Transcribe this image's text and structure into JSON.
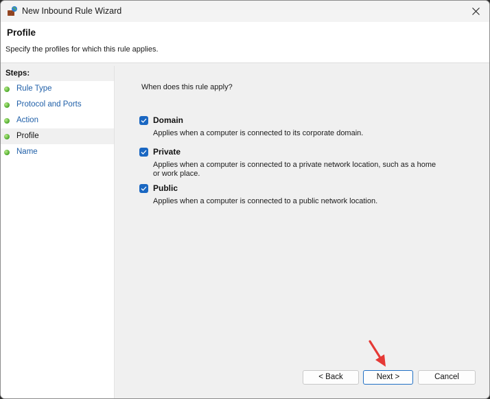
{
  "window": {
    "title": "New Inbound Rule Wizard",
    "icon": "firewall-icon",
    "close_icon": "close-icon"
  },
  "header": {
    "title": "Profile",
    "subtitle": "Specify the profiles for which this rule applies."
  },
  "sidebar": {
    "heading": "Steps:",
    "items": [
      {
        "label": "Rule Type",
        "active": false
      },
      {
        "label": "Protocol and Ports",
        "active": false
      },
      {
        "label": "Action",
        "active": false
      },
      {
        "label": "Profile",
        "active": true
      },
      {
        "label": "Name",
        "active": false
      }
    ]
  },
  "main": {
    "question": "When does this rule apply?",
    "options": [
      {
        "label": "Domain",
        "checked": true,
        "description": "Applies when a computer is connected to its corporate domain."
      },
      {
        "label": "Private",
        "checked": true,
        "description": "Applies when a computer is connected to a private network location, such as a home or work place."
      },
      {
        "label": "Public",
        "checked": true,
        "description": "Applies when a computer is connected to a public network location."
      }
    ]
  },
  "buttons": {
    "back": "< Back",
    "next": "Next >",
    "cancel": "Cancel"
  },
  "colors": {
    "accent": "#1a67c2",
    "link": "#1f5fa8",
    "annotation_arrow": "#e53935"
  }
}
